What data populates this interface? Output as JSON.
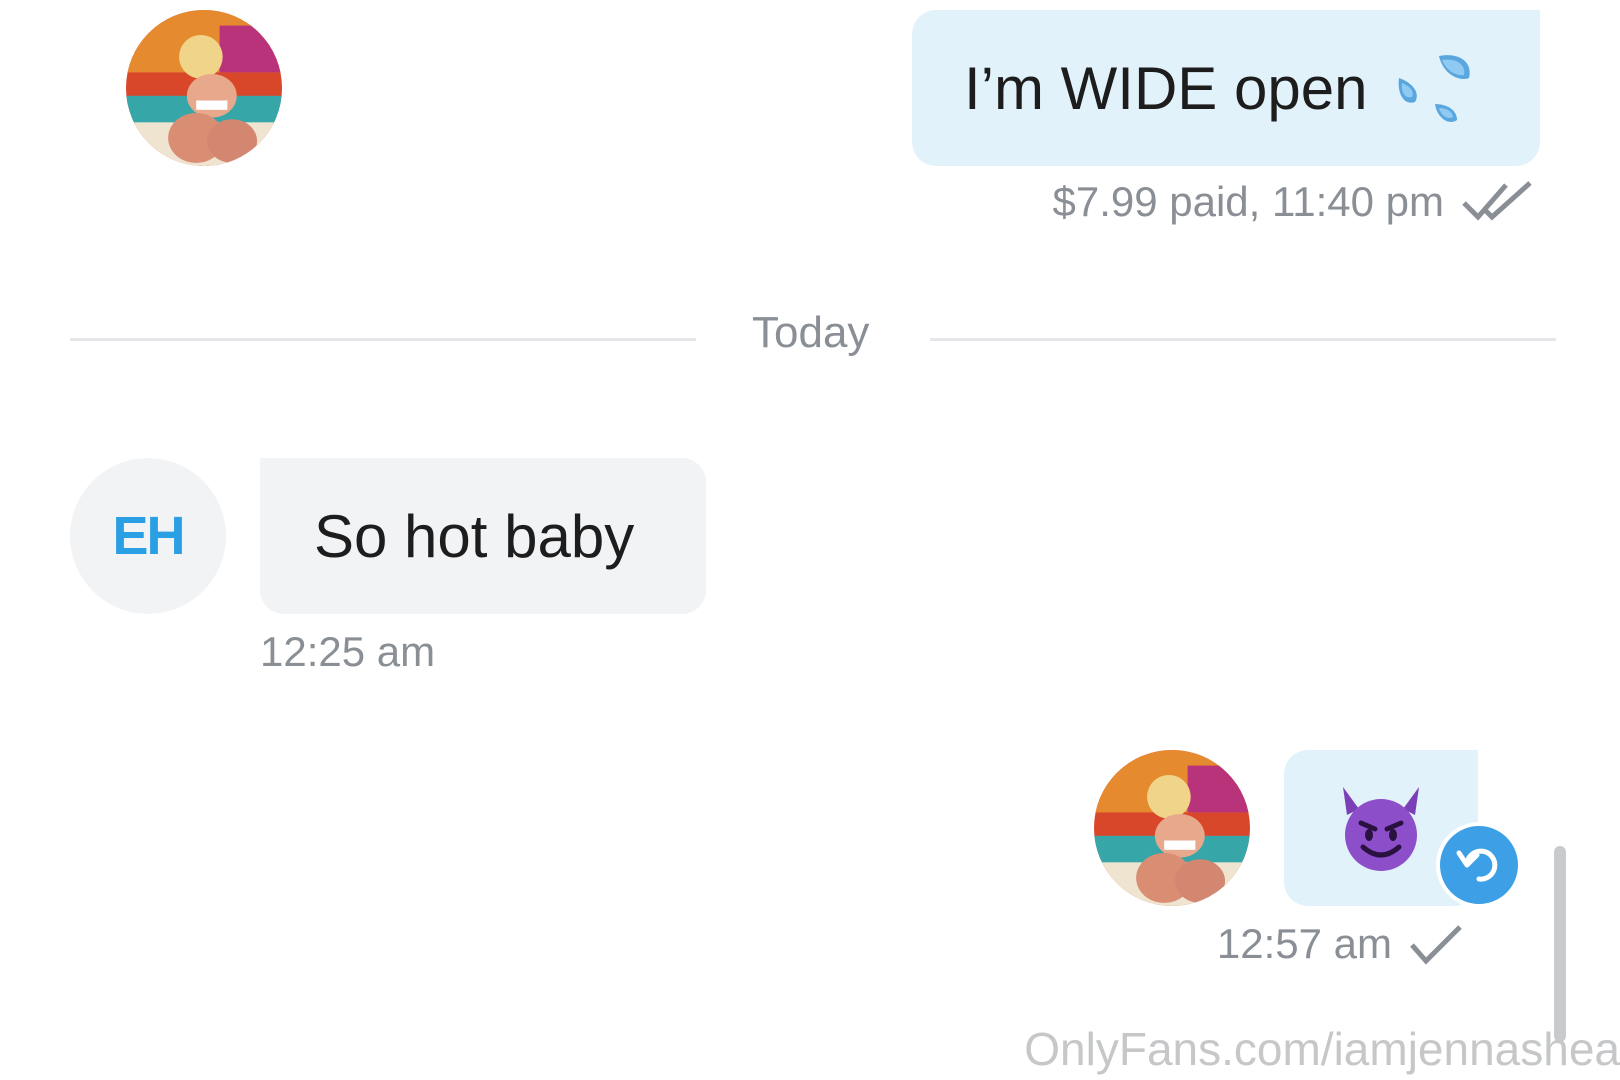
{
  "messages": {
    "first": {
      "text": "I’m WIDE open",
      "emoji_icon": "sweat-droplets-icon",
      "meta": "$7.99 paid, 11:40 pm",
      "status_icon": "double-check-icon"
    },
    "divider": {
      "label": "Today"
    },
    "second": {
      "avatar_initials": "EH",
      "text": "So hot baby",
      "meta": "12:25 am"
    },
    "third": {
      "emoji": "😈",
      "emoji_icon": "smiling-devil-icon",
      "meta": "12:57 am",
      "status_icon": "check-icon",
      "action_icon": "undo-icon"
    }
  },
  "watermark": "OnlyFans.com/iamjennashea",
  "colors": {
    "outgoing_bubble": "#e2f2fb",
    "incoming_bubble": "#f2f3f5",
    "accent": "#3da0e6",
    "meta_text": "#8a8f96",
    "initials": "#2b9fe3"
  }
}
